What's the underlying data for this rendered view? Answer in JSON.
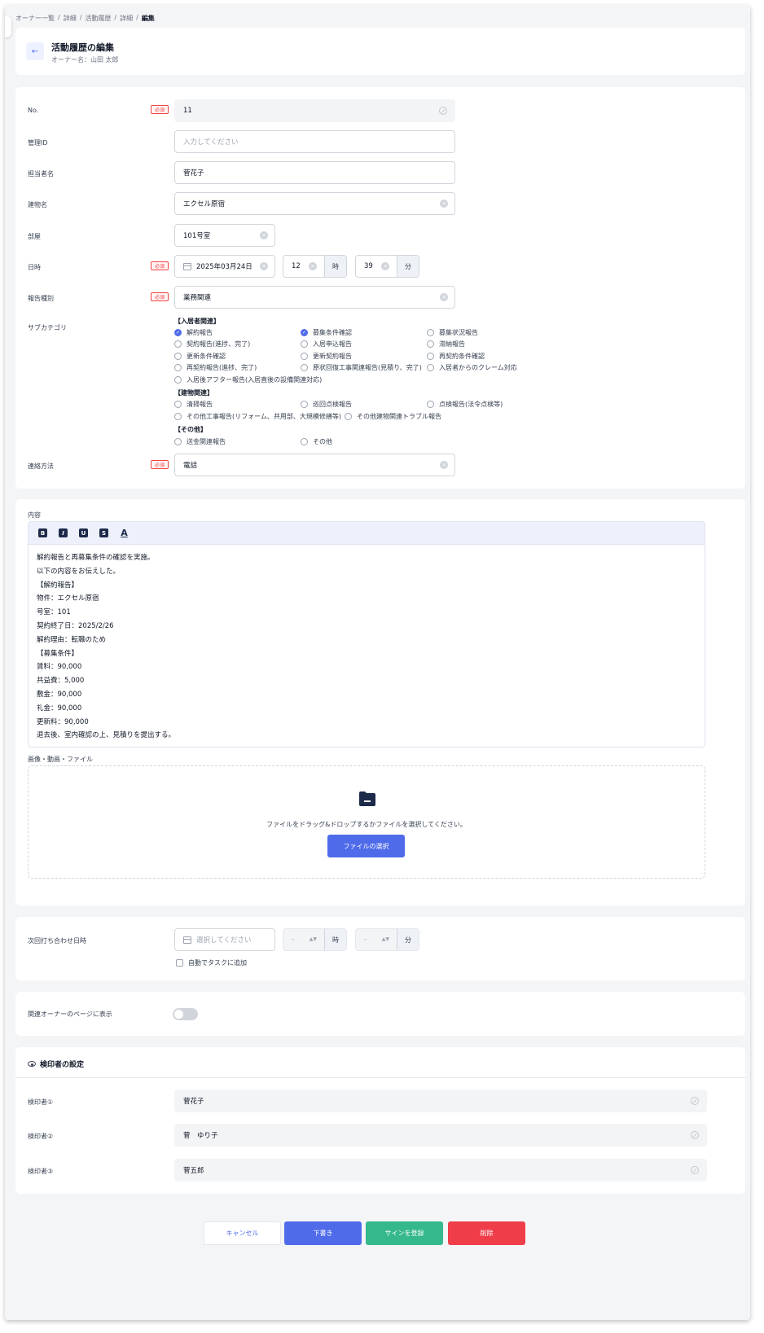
{
  "breadcrumb": [
    "オーナー一覧",
    "詳細",
    "活動履歴",
    "詳細",
    "編集"
  ],
  "header": {
    "title": "活動履歴の編集",
    "owner_label": "オーナー名：山田 太郎"
  },
  "required_label": "必須",
  "form": {
    "no": {
      "label": "No.",
      "value": "11"
    },
    "management_id": {
      "label": "管理ID",
      "placeholder": "入力してください"
    },
    "reporter": {
      "label": "担当者名",
      "value": "菅花子"
    },
    "building": {
      "label": "建物名",
      "value": "エクセル原宿"
    },
    "room": {
      "label": "部屋",
      "value": "101号室"
    },
    "datetime": {
      "label": "日時",
      "date": "2025年03月24日",
      "hour": "12",
      "hour_unit": "時",
      "minute": "39",
      "minute_unit": "分"
    },
    "report_type": {
      "label": "報告種別",
      "value": "業務関連"
    },
    "subcategory": {
      "label": "サブカテゴリ",
      "groups": [
        {
          "title": "【入居者関連】",
          "items": [
            {
              "label": "解約報告",
              "checked": true
            },
            {
              "label": "募集条件確認",
              "checked": true
            },
            {
              "label": "募集状況報告",
              "checked": false
            },
            {
              "label": "契約報告(進捗、完了)",
              "checked": false
            },
            {
              "label": "入居申込報告",
              "checked": false
            },
            {
              "label": "滞納報告",
              "checked": false
            },
            {
              "label": "更新条件確認",
              "checked": false
            },
            {
              "label": "更新契約報告",
              "checked": false
            },
            {
              "label": "再契約条件確認",
              "checked": false
            },
            {
              "label": "再契約報告(進捗、完了)",
              "checked": false
            },
            {
              "label": "原状回復工事関連報告(見積り、完了)",
              "checked": false
            },
            {
              "label": "入居者からのクレーム対応",
              "checked": false
            },
            {
              "label": "入居後アフター報告(入居直後の設備関連対応)",
              "checked": false
            }
          ]
        },
        {
          "title": "【建物関連】",
          "items": [
            {
              "label": "清掃報告",
              "checked": false
            },
            {
              "label": "巡回点検報告",
              "checked": false
            },
            {
              "label": "点検報告(法令点検等)",
              "checked": false
            },
            {
              "label": "その他工事報告(リフォーム、共用部、大規模修繕等)",
              "checked": false
            },
            {
              "label": "その他建物関連トラブル報告",
              "checked": false
            }
          ]
        },
        {
          "title": "【その他】",
          "items": [
            {
              "label": "送金関連報告",
              "checked": false
            },
            {
              "label": "その他",
              "checked": false
            }
          ]
        }
      ]
    },
    "contact_method": {
      "label": "連絡方法",
      "value": "電話"
    }
  },
  "content": {
    "label": "内容",
    "toolbar": [
      "B",
      "I",
      "U",
      "S",
      "A"
    ],
    "lines": [
      "解約報告と再募集条件の確認を実施。",
      "以下の内容をお伝えした。",
      "【解約報告】",
      "物件：エクセル原宿",
      "号室：101",
      "契約終了日：2025/2/26",
      "解約理由：転職のため",
      "【募集条件】",
      "賃料：90,000",
      "共益費：5,000",
      "敷金：90,000",
      "礼金：90,000",
      "更新料：90,000",
      "退去後、室内確認の上、見積りを提出する。"
    ]
  },
  "files": {
    "label": "画像・動画・ファイル",
    "drop_text": "ファイルをドラッグ&ドロップするかファイルを選択してください。",
    "select_button": "ファイルの選択"
  },
  "next_meeting": {
    "label": "次回打ち合わせ日時",
    "date_placeholder": "選択してください",
    "hour_placeholder": "-",
    "hour_unit": "時",
    "minute_placeholder": "-",
    "minute_unit": "分",
    "auto_task": "自動でタスクに追加"
  },
  "owner_page": {
    "label": "関連オーナーのページに表示",
    "enabled": false
  },
  "approvers": {
    "title": "検印者の設定",
    "rows": [
      {
        "label": "検印者①",
        "value": "菅花子"
      },
      {
        "label": "検印者②",
        "value": "菅　ゆり子"
      },
      {
        "label": "検印者③",
        "value": "菅五郎"
      }
    ]
  },
  "actions": {
    "cancel": "キャンセル",
    "draft": "下書き",
    "sign": "サインを登録",
    "delete": "削除"
  },
  "colors": {
    "primary": "#4f6bea",
    "success": "#35b88b",
    "danger": "#ef3e4a"
  }
}
